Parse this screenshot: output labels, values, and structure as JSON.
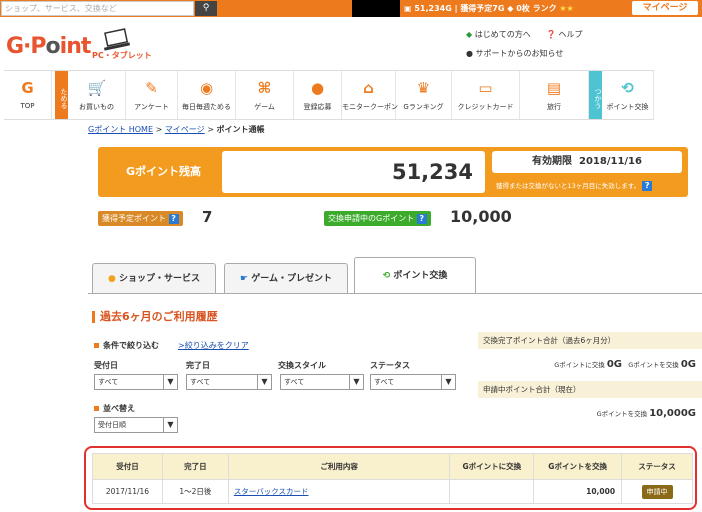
{
  "topbar": {
    "search_placeholder": "ショップ、サービス、交換など",
    "balance": "51,234G",
    "pending": "獲得予定7G",
    "count": "0枚",
    "rank": "ランク",
    "mypage": "マイページ"
  },
  "header": {
    "logo_main": "G·Point",
    "logo_badge": "PC・タブレット",
    "beginner_link": "はじめての方へ",
    "help_link": "ヘルプ",
    "support_link": "サポートからのお知らせ"
  },
  "nav": {
    "top": "TOP",
    "tameru": "ためる",
    "tsukau": "つかう",
    "items": [
      "お買いもの",
      "アンケート",
      "毎日毎週ためる",
      "ゲーム",
      "登録応募",
      "モニタークーポン",
      "Gランキング",
      "クレジットカード",
      "旅行",
      "ポイント交換"
    ]
  },
  "breadcrumb": {
    "home": "Gポイント HOME",
    "sep1": ">",
    "mypage": "マイページ",
    "sep2": ">",
    "current": "ポイント通帳"
  },
  "balance": {
    "label": "Gポイント残高",
    "value": "51,234",
    "expiry_label": "有効期限",
    "expiry_date": "2018/11/16",
    "expiry_note": "獲得または交換がないと13ヶ月目に失効します。"
  },
  "pending": {
    "label": "獲得予定ポイント",
    "value": "7",
    "exchange_label": "交換申請中のGポイント",
    "exchange_value": "10,000"
  },
  "tabs": [
    "ショップ・サービス",
    "ゲーム・プレゼント",
    "ポイント交換"
  ],
  "history": {
    "title": "過去6ヶ月のご利用履歴",
    "filter_title": "条件で絞り込む",
    "clear_filter": ">絞り込みをクリア",
    "filters": [
      {
        "label": "受付日",
        "value": "すべて"
      },
      {
        "label": "完了日",
        "value": "すべて"
      },
      {
        "label": "交換スタイル",
        "value": "すべて"
      },
      {
        "label": "ステータス",
        "value": "すべて"
      }
    ],
    "sort_title": "並べ替え",
    "sort_value": "受付日順"
  },
  "summary": {
    "completed_title": "交換完了ポイント合計（過去6ヶ月分）",
    "completed_g_label": "Gポイントに交換",
    "completed_g_value": "0G",
    "completed_from_label": "Gポイントを交換",
    "completed_from_value": "0G",
    "pending_title": "申請中ポイント合計（現在）",
    "pending_label": "Gポイントを交換",
    "pending_value": "10,000G"
  },
  "table": {
    "headers": [
      "受付日",
      "完了日",
      "ご利用内容",
      "Gポイントに交換",
      "Gポイントを交換",
      "ステータス"
    ],
    "rows": [
      {
        "received": "2017/11/16",
        "completed": "1〜2日後",
        "content": "スターバックスカード",
        "to_g": "",
        "from_g": "10,000",
        "status": "申請中"
      }
    ]
  }
}
